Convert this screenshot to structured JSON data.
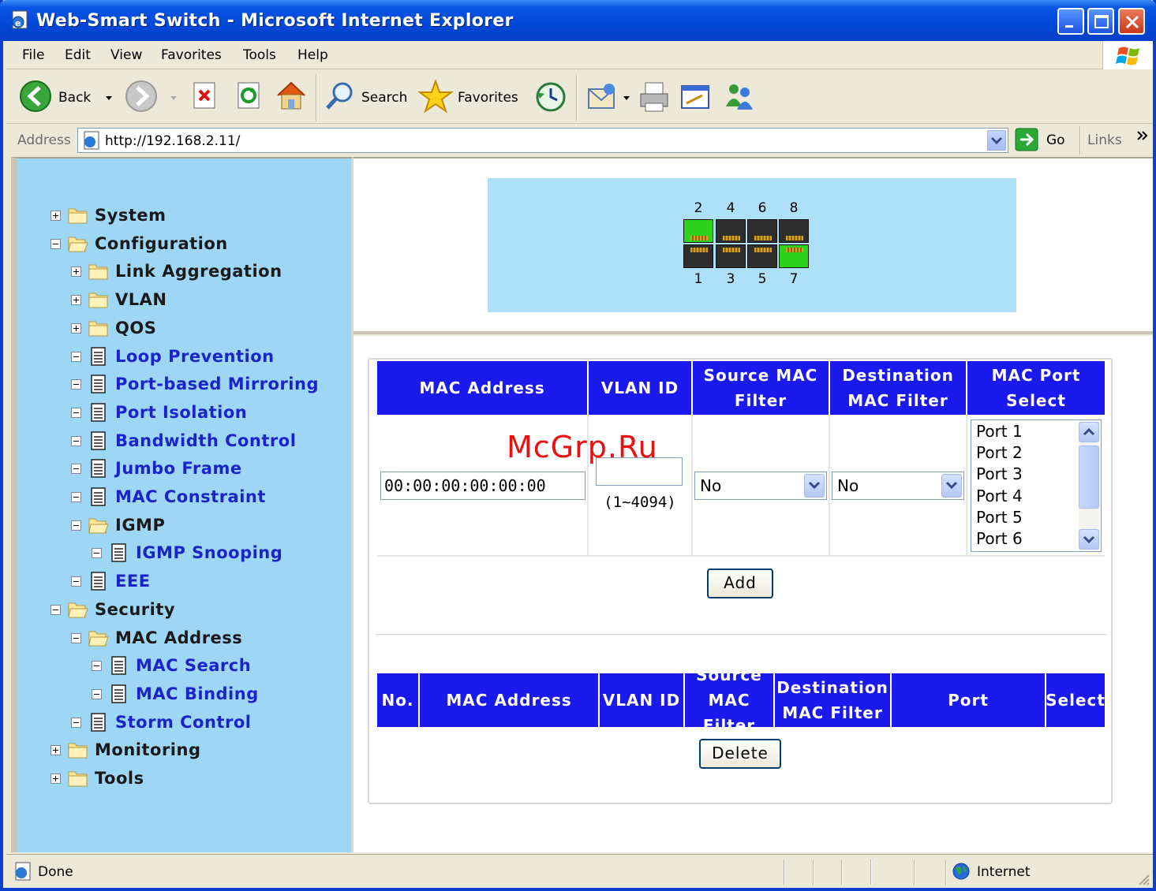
{
  "window": {
    "title": "Web-Smart Switch - Microsoft Internet Explorer"
  },
  "menu": [
    "File",
    "Edit",
    "View",
    "Favorites",
    "Tools",
    "Help"
  ],
  "toolbar": {
    "back": "Back",
    "search": "Search",
    "favorites": "Favorites"
  },
  "address": {
    "label": "Address",
    "url": "http://192.168.2.11/",
    "go": "Go",
    "links": "Links"
  },
  "tree": [
    {
      "label": "System",
      "expander": "plus",
      "icon": "folder",
      "link": false
    },
    {
      "label": "Configuration",
      "expander": "minus",
      "icon": "open-folder",
      "link": false
    },
    {
      "label": "Link Aggregation",
      "expander": "plus",
      "icon": "folder",
      "link": false
    },
    {
      "label": "VLAN",
      "expander": "plus",
      "icon": "folder",
      "link": false
    },
    {
      "label": "QOS",
      "expander": "plus",
      "icon": "folder",
      "link": false
    },
    {
      "label": "Loop Prevention",
      "expander": "minus",
      "icon": "page",
      "link": true
    },
    {
      "label": "Port-based Mirroring",
      "expander": "minus",
      "icon": "page",
      "link": true
    },
    {
      "label": "Port Isolation",
      "expander": "minus",
      "icon": "page",
      "link": true
    },
    {
      "label": "Bandwidth Control",
      "expander": "minus",
      "icon": "page",
      "link": true
    },
    {
      "label": "Jumbo Frame",
      "expander": "minus",
      "icon": "page",
      "link": true
    },
    {
      "label": "MAC Constraint",
      "expander": "minus",
      "icon": "page",
      "link": true
    },
    {
      "label": "IGMP",
      "expander": "minus",
      "icon": "open-folder",
      "link": false
    },
    {
      "label": "IGMP Snooping",
      "expander": "minus",
      "icon": "page",
      "link": true
    },
    {
      "label": "EEE",
      "expander": "minus",
      "icon": "page",
      "link": true
    },
    {
      "label": "Security",
      "expander": "minus",
      "icon": "open-folder",
      "link": false
    },
    {
      "label": "MAC Address",
      "expander": "minus",
      "icon": "open-folder",
      "link": false
    },
    {
      "label": "MAC Search",
      "expander": "minus",
      "icon": "page",
      "link": true
    },
    {
      "label": "MAC Binding",
      "expander": "minus",
      "icon": "page",
      "link": true
    },
    {
      "label": "Storm Control",
      "expander": "minus",
      "icon": "page",
      "link": true
    },
    {
      "label": "Monitoring",
      "expander": "plus",
      "icon": "folder",
      "link": false
    },
    {
      "label": "Tools",
      "expander": "plus",
      "icon": "folder",
      "link": false
    }
  ],
  "ports": {
    "top_labels": [
      "2",
      "4",
      "6",
      "8"
    ],
    "bottom_labels": [
      "1",
      "3",
      "5",
      "7"
    ],
    "link_up": [
      "2",
      "7"
    ]
  },
  "add_form": {
    "headers": [
      "MAC Address",
      "VLAN ID",
      "Source MAC Filter",
      "Destination MAC Filter",
      "MAC Port Select"
    ],
    "mac_value": "00:00:00:00:00:00",
    "vlan_value": "",
    "vlan_hint": "(1~4094)",
    "source_filter": "No",
    "dest_filter": "No",
    "port_options": [
      "Port 1",
      "Port 2",
      "Port 3",
      "Port 4",
      "Port 5",
      "Port 6"
    ],
    "add_button": "Add"
  },
  "list_table": {
    "headers": [
      "No.",
      "MAC Address",
      "VLAN ID",
      "Source MAC Filter",
      "Destination MAC Filter",
      "Port",
      "Select"
    ],
    "delete_button": "Delete"
  },
  "status": {
    "text": "Done",
    "zone": "Internet"
  },
  "watermark": "McGrp.Ru",
  "colors": {
    "header_blue": "#1a1aee",
    "tree_bg": "#9ed6f5",
    "port_panel": "#aee0f8",
    "link_green": "#2dd21c"
  }
}
